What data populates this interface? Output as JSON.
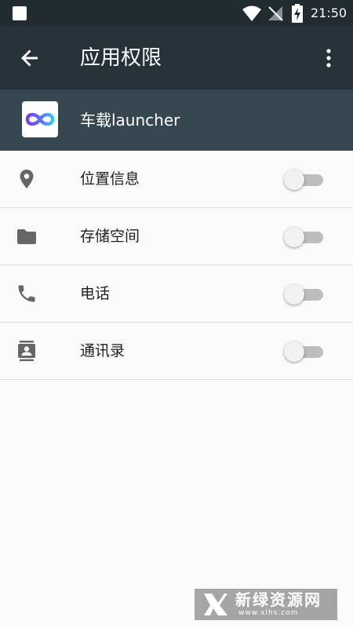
{
  "status_bar": {
    "time": "21:50"
  },
  "app_bar": {
    "title": "应用权限"
  },
  "app": {
    "name": "车载launcher"
  },
  "permissions": [
    {
      "label": "位置信息",
      "icon": "location-icon",
      "enabled": false
    },
    {
      "label": "存储空间",
      "icon": "folder-icon",
      "enabled": false
    },
    {
      "label": "电话",
      "icon": "phone-icon",
      "enabled": false
    },
    {
      "label": "通讯录",
      "icon": "contacts-icon",
      "enabled": false
    }
  ],
  "watermark": {
    "title": "新绿资源网",
    "url": "www.xlhs.com"
  },
  "colors": {
    "status_bar": "#222c30",
    "app_bar": "#263238",
    "app_header": "#37474f",
    "icon_gray": "#666666",
    "toggle_track": "#bdbdbd",
    "toggle_thumb": "#f1f1f1"
  }
}
